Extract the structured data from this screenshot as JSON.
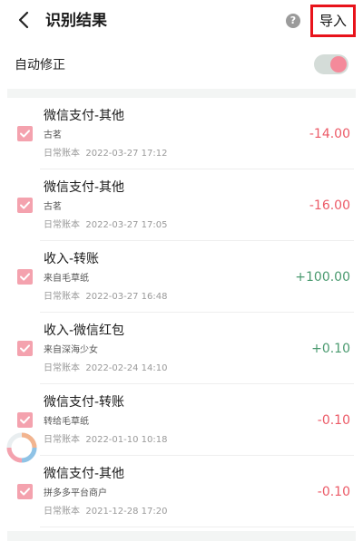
{
  "header": {
    "title": "识别结果",
    "help_glyph": "?",
    "import_label": "导入",
    "import_highlight_color": "#e8131b"
  },
  "auto_correct": {
    "label": "自动修正",
    "enabled": true
  },
  "colors": {
    "expense": "#ec5a67",
    "income": "#4a9a6f",
    "checkbox": "#f4a2ae",
    "toggle_knob": "#f48a9a"
  },
  "records": [
    {
      "title": "微信支付-其他",
      "merchant": "古茗",
      "book": "日常账本",
      "datetime": "2022-03-27 17:12",
      "amount": "-14.00",
      "type": "expense",
      "checked": true
    },
    {
      "title": "微信支付-其他",
      "merchant": "古茗",
      "book": "日常账本",
      "datetime": "2022-03-27 17:05",
      "amount": "-16.00",
      "type": "expense",
      "checked": true
    },
    {
      "title": "收入-转账",
      "merchant": "来自毛草纸",
      "book": "日常账本",
      "datetime": "2022-03-27 16:48",
      "amount": "+100.00",
      "type": "income",
      "checked": true
    },
    {
      "title": "收入-微信红包",
      "merchant": "来自深海少女",
      "book": "日常账本",
      "datetime": "2022-02-24 14:10",
      "amount": "+0.10",
      "type": "income",
      "checked": true
    },
    {
      "title": "微信支付-转账",
      "merchant": "转给毛草纸",
      "book": "日常账本",
      "datetime": "2022-01-10 10:18",
      "amount": "-0.10",
      "type": "expense",
      "checked": true
    },
    {
      "title": "微信支付-其他",
      "merchant": "拼多多平台商户",
      "book": "日常账本",
      "datetime": "2021-12-28 17:20",
      "amount": "-0.10",
      "type": "expense",
      "checked": true
    }
  ],
  "floating_icon": "loading-ring-icon"
}
